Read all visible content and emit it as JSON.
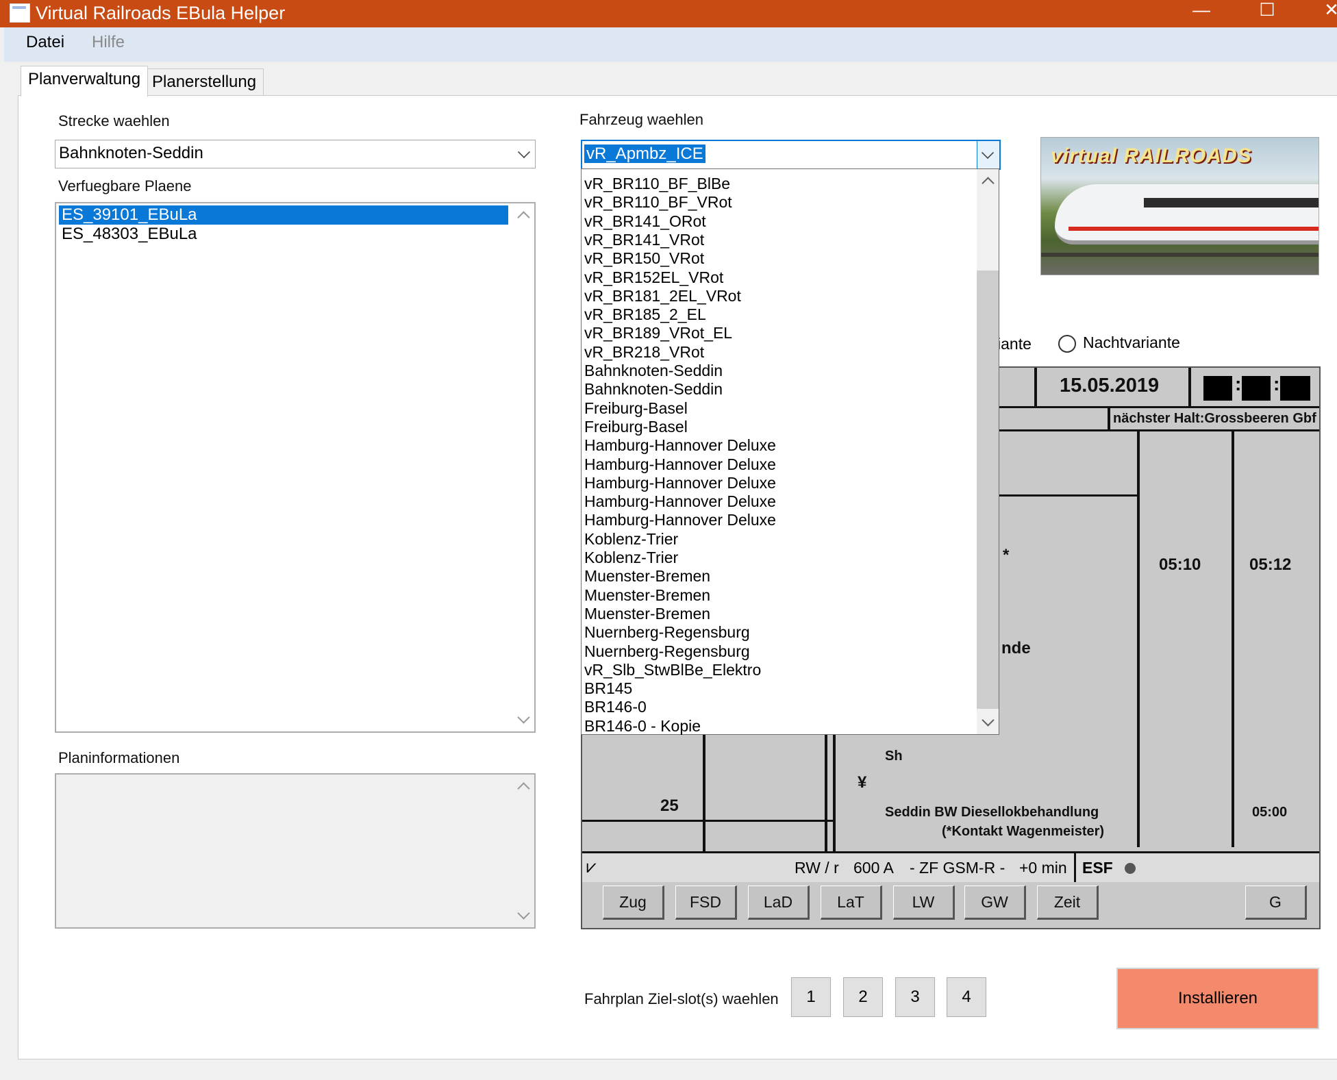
{
  "window": {
    "title": "Virtual Railroads EBula Helper",
    "minimize": "—",
    "maximize": "☐",
    "close": "✕"
  },
  "menu": {
    "file": "Datei",
    "help": "Hilfe"
  },
  "tabs": [
    {
      "label": "Planverwaltung"
    },
    {
      "label": "Planerstellung"
    }
  ],
  "route": {
    "label": "Strecke waehlen",
    "value": "Bahnknoten-Seddin"
  },
  "plans": {
    "label": "Verfuegbare Plaene",
    "items": [
      "ES_39101_EBuLa",
      "ES_48303_EBuLa"
    ],
    "selected": "ES_39101_EBuLa"
  },
  "planinfo": {
    "label": "Planinformationen"
  },
  "vehicle": {
    "label": "Fahrzeug waehlen",
    "value": "vR_Apmbz_ICE",
    "options": [
      "vR_BR110_BF_BlBe",
      "vR_BR110_BF_VRot",
      "vR_BR141_ORot",
      "vR_BR141_VRot",
      "vR_BR150_VRot",
      "vR_BR152EL_VRot",
      "vR_BR181_2EL_VRot",
      "vR_BR185_2_EL",
      "vR_BR189_VRot_EL",
      "vR_BR218_VRot",
      "Bahnknoten-Seddin",
      "Bahnknoten-Seddin",
      "Freiburg-Basel",
      "Freiburg-Basel",
      "Hamburg-Hannover Deluxe",
      "Hamburg-Hannover Deluxe",
      "Hamburg-Hannover Deluxe",
      "Hamburg-Hannover Deluxe",
      "Hamburg-Hannover Deluxe",
      "Koblenz-Trier",
      "Koblenz-Trier",
      "Muenster-Bremen",
      "Muenster-Bremen",
      "Muenster-Bremen",
      "Nuernberg-Regensburg",
      "Nuernberg-Regensburg",
      "vR_Slb_StwBlBe_Elektro",
      "BR145",
      "BR146-0",
      "BR146-0 - Kopie"
    ]
  },
  "preview": {
    "logo": "virtual RAILROADS"
  },
  "variants": {
    "day_partial": "iante",
    "night": "Nachtvariante"
  },
  "ebula": {
    "date": "15.05.2019",
    "next_stop": "nächster Halt:Grossbeeren Gbf",
    "time1": "05:10",
    "time2": "05:12",
    "star": "*",
    "nde": "nde",
    "speed": "25",
    "sh": "Sh",
    "yen": "¥",
    "station_line1": "Seddin BW Diesellokbehandlung",
    "station_line2": "(*Kontakt Wagenmeister)",
    "time3": "05:00",
    "status": {
      "rw": "RW / r",
      "amp": "600 A",
      "gsm": "- ZF GSM-R -",
      "delay": "+0 min",
      "esf": "ESF"
    },
    "buttons": [
      "Zug",
      "FSD",
      "LaD",
      "LaT",
      "LW",
      "GW",
      "Zeit",
      "G"
    ]
  },
  "slots": {
    "label": "Fahrplan Ziel-slot(s) waehlen",
    "items": [
      "1",
      "2",
      "3",
      "4"
    ]
  },
  "install": {
    "label": "Installieren"
  },
  "colors": {
    "titlebar": "#c94b14",
    "selection": "#0a78d7",
    "install": "#f5896b",
    "menubar": "#dce7f3"
  }
}
